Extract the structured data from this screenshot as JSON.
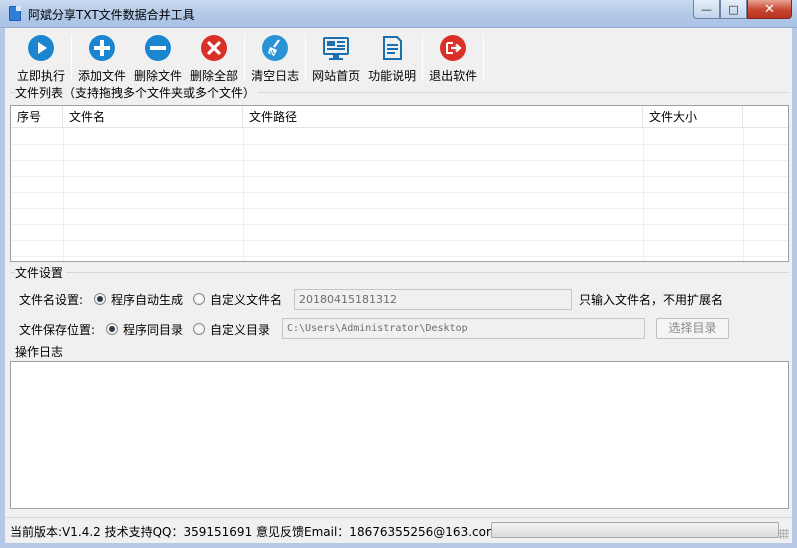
{
  "window": {
    "title": "阿斌分享TXT文件数据合并工具",
    "controls": {
      "minimize": "—",
      "maximize": "□",
      "close": "✕"
    }
  },
  "toolbar": {
    "buttons": [
      {
        "label": "立即执行",
        "icon": "play-icon",
        "color": "#1a86d0"
      },
      {
        "label": "添加文件",
        "icon": "plus-icon",
        "color": "#1a86d0"
      },
      {
        "label": "删除文件",
        "icon": "minus-icon",
        "color": "#1a86d0"
      },
      {
        "label": "删除全部",
        "icon": "x-circle-icon",
        "color": "#d9302a"
      },
      {
        "label": "清空日志",
        "icon": "broom-icon",
        "color": "#1a86d0"
      },
      {
        "label": "网站首页",
        "icon": "monitor-icon",
        "color": "#1a6fb0"
      },
      {
        "label": "功能说明",
        "icon": "document-icon",
        "color": "#1a6fb0"
      },
      {
        "label": "退出软件",
        "icon": "exit-icon",
        "color": "#d9302a"
      }
    ]
  },
  "file_list": {
    "group_title": "文件列表（支持拖拽多个文件夹或多个文件）",
    "columns": [
      "序号",
      "文件名",
      "文件路径",
      "文件大小"
    ],
    "rows": []
  },
  "file_settings": {
    "group_title": "文件设置",
    "name_setting": {
      "label": "文件名设置:",
      "option_auto": "程序自动生成",
      "option_custom": "自定义文件名",
      "selected": "auto",
      "value": "20180415181312",
      "hint": "只输入文件名，不用扩展名"
    },
    "save_location": {
      "label": "文件保存位置:",
      "option_same": "程序同目录",
      "option_custom": "自定义目录",
      "selected": "same",
      "value": "C:\\Users\\Administrator\\Desktop",
      "choose_button": "选择目录"
    }
  },
  "log": {
    "group_title": "操作日志"
  },
  "status": {
    "text": "当前版本:V1.4.2  技术支持QQ：359151691  意见反馈Email：18676355256@163.com",
    "progress": 0
  }
}
